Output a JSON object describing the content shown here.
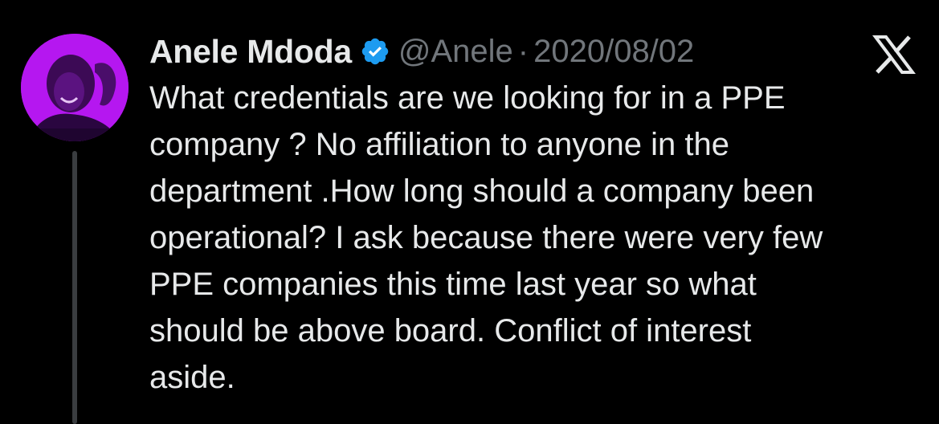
{
  "tweet": {
    "author_name": "Anele Mdoda",
    "handle": "@Anele",
    "separator": "·",
    "date": "2020/08/02",
    "verified": true,
    "text_lines": [
      "What credentials are we looking for in a PPE",
      "company ? No affiliation to anyone in the",
      "department .How long should a company been",
      "operational? I ask because there were very few",
      "PPE companies this time last year so what",
      "should be above board. Conflict of interest",
      "aside."
    ]
  },
  "icons": {
    "avatar": "avatar-photo",
    "verified": "verified-badge-icon",
    "platform": "x-logo-icon"
  },
  "colors": {
    "background": "#000000",
    "text_primary": "#e7e9ea",
    "text_secondary": "#71767b",
    "verified_blue": "#1d9bf0",
    "avatar_purple": "#b517f0",
    "thread_line": "#3a3d40"
  }
}
